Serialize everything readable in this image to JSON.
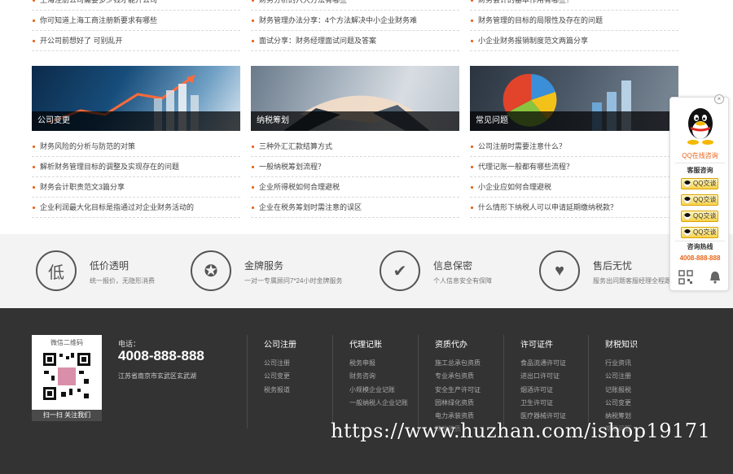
{
  "news_columns": [
    {
      "rows": [
        "上海注册公司需要多少钱才能开公司",
        "你可知道上海工商注册新要求有哪些",
        "开公司前想好了 可别乱开"
      ]
    },
    {
      "rows": [
        "财务分析的六大方法有哪些",
        "财务管理办法分享：4个方法解决中小企业财务难",
        "面试分享：财务经理面试问题及答案"
      ]
    },
    {
      "rows": [
        "财务会计的基本作用有哪些？",
        "财务管理的目标的局限性及存在的问题",
        "小企业财务报销制度范文两篇分享"
      ]
    }
  ],
  "cards": [
    {
      "caption": "公司变更",
      "rows": [
        "财务风险的分析与防范的对策",
        "解析财务管理目标的调整及实现存在的问题",
        "财务会计职责范文3篇分享",
        "企业利润最大化目标是指通过对企业财务活动的"
      ]
    },
    {
      "caption": "纳税筹划",
      "rows": [
        "三种外汇汇款结算方式",
        "一般纳税筹划流程？",
        "企业所得税如何合理避税",
        "企业在税务筹划时需注意的误区"
      ]
    },
    {
      "caption": "常见问题",
      "rows": [
        "公司注册时需要注意什么？",
        "代理记账一般都有哪些流程？",
        "小企业应如何合理避税",
        "什么情形下纳税人可以申请延期缴纳税款？"
      ]
    }
  ],
  "features": [
    {
      "icon": "低",
      "title": "低价透明",
      "desc": "统一报价，无隐形消费"
    },
    {
      "icon": "✪",
      "title": "金牌服务",
      "desc": "一对一专属顾问7*24小时金牌服务"
    },
    {
      "icon": "✔",
      "title": "信息保密",
      "desc": "个人信息安全有保障"
    },
    {
      "icon": "♥",
      "title": "售后无忧",
      "desc": "服务出问题客服经理全程跟进"
    }
  ],
  "footer": {
    "qr_title": "微信二维码",
    "qr_caption": "扫一扫 关注我们",
    "tel_label": "电话：",
    "tel": "4008-888-888",
    "address": "江苏省南京市玄武区玄武湖",
    "columns": [
      {
        "title": "公司注册",
        "links": [
          "公司注册",
          "公司变更",
          "税务报道"
        ]
      },
      {
        "title": "代理记账",
        "links": [
          "税务申报",
          "财务咨询",
          "小规模企业记账",
          "一般纳税人企业记账"
        ]
      },
      {
        "title": "资质代办",
        "links": [
          "施工总承包资质",
          "专业承包资质",
          "安全生产许可证",
          "园林绿化资质",
          "电力承装资质",
          "其他资质"
        ]
      },
      {
        "title": "许可证件",
        "links": [
          "食品流通许可证",
          "进出口许可证",
          "烟酒许可证",
          "卫生许可证",
          "医疗器械许可证"
        ]
      },
      {
        "title": "财税知识",
        "links": [
          "行业资讯",
          "公司注册",
          "记账报税",
          "公司变更",
          "纳税筹划",
          "常见问题"
        ]
      }
    ]
  },
  "watermark": "https://www.huzhan.com/ishop19171",
  "qq_widget": {
    "close": "×",
    "online_label": "QQ在线咨询",
    "service_title": "客服咨询",
    "buttons": [
      "QQ交谈",
      "QQ交谈",
      "QQ交谈",
      "QQ交谈"
    ],
    "hotline_title": "咨询热线",
    "hotline": "4008-888-888"
  },
  "colors": {
    "accent": "#e8651a",
    "footer_bg": "#333333",
    "band_bg": "#f3f3f3"
  }
}
